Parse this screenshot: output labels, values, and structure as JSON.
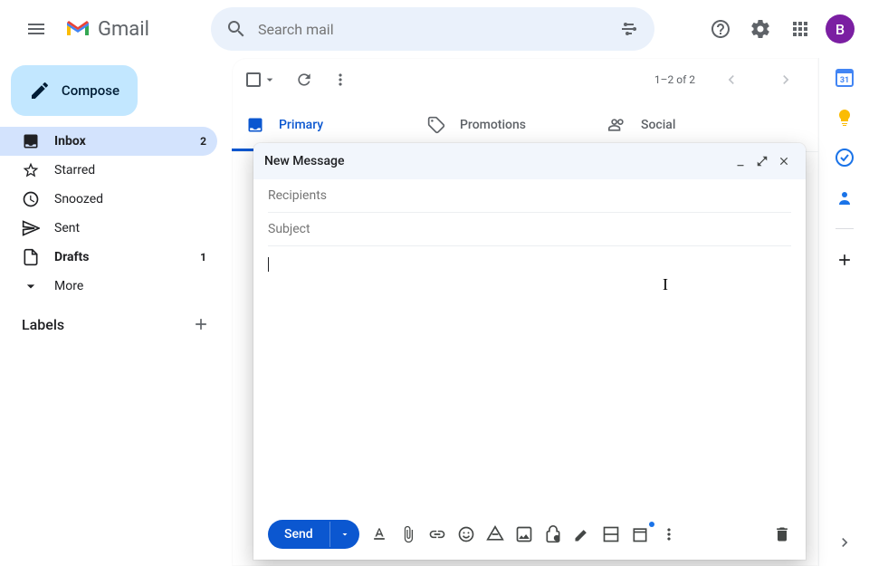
{
  "header": {
    "app_name": "Gmail",
    "search_placeholder": "Search mail",
    "avatar_initial": "B"
  },
  "sidebar": {
    "compose_label": "Compose",
    "items": [
      {
        "label": "Inbox",
        "count": "2",
        "active": true
      },
      {
        "label": "Starred",
        "count": ""
      },
      {
        "label": "Snoozed",
        "count": ""
      },
      {
        "label": "Sent",
        "count": ""
      },
      {
        "label": "Drafts",
        "count": "1"
      },
      {
        "label": "More",
        "count": ""
      }
    ],
    "labels_header": "Labels"
  },
  "toolbar": {
    "page_info": "1–2 of 2"
  },
  "tabs": {
    "primary": "Primary",
    "promotions": "Promotions",
    "social": "Social"
  },
  "compose_window": {
    "title": "New Message",
    "recipients_placeholder": "Recipients",
    "subject_placeholder": "Subject",
    "send_label": "Send"
  },
  "right_rail": {
    "calendar_day": "31"
  }
}
